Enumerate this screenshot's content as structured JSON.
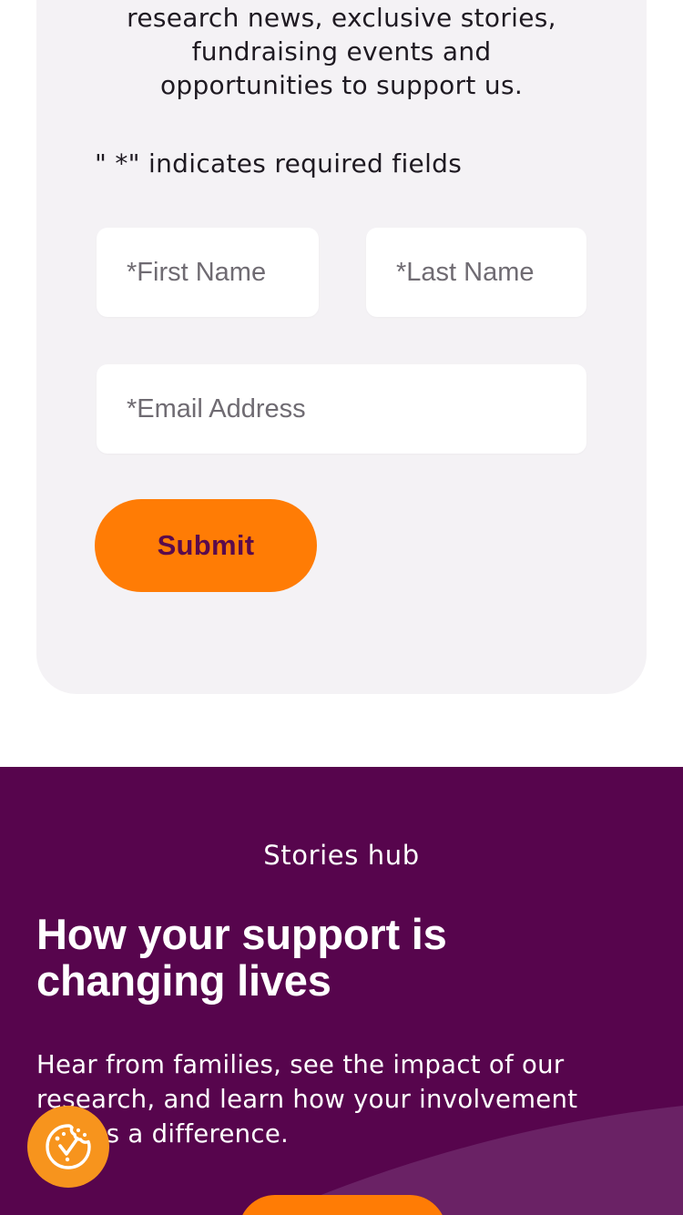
{
  "newsletter": {
    "intro_lines": [
      "research news, exclusive stories,",
      "fundraising events and",
      "opportunities to support us."
    ],
    "required_note": "\" *\" indicates required fields",
    "first_name_placeholder": "*First Name",
    "last_name_placeholder": "*Last Name",
    "email_placeholder": "*Email Address",
    "submit_label": "Submit"
  },
  "stories": {
    "eyebrow": "Stories hub",
    "headline_lines": [
      "How your support is",
      "changing lives"
    ],
    "body_lines": [
      "Hear from families, see the impact of our",
      "research, and learn how your involvement",
      "makes a difference."
    ]
  },
  "cookie_button": {
    "icon": "cookie-check-icon"
  },
  "colors": {
    "accent_orange": "#ff7c05",
    "brand_purple": "#57054d",
    "card_background": "#f4f2f5",
    "cookie_orange": "#f7941d"
  }
}
